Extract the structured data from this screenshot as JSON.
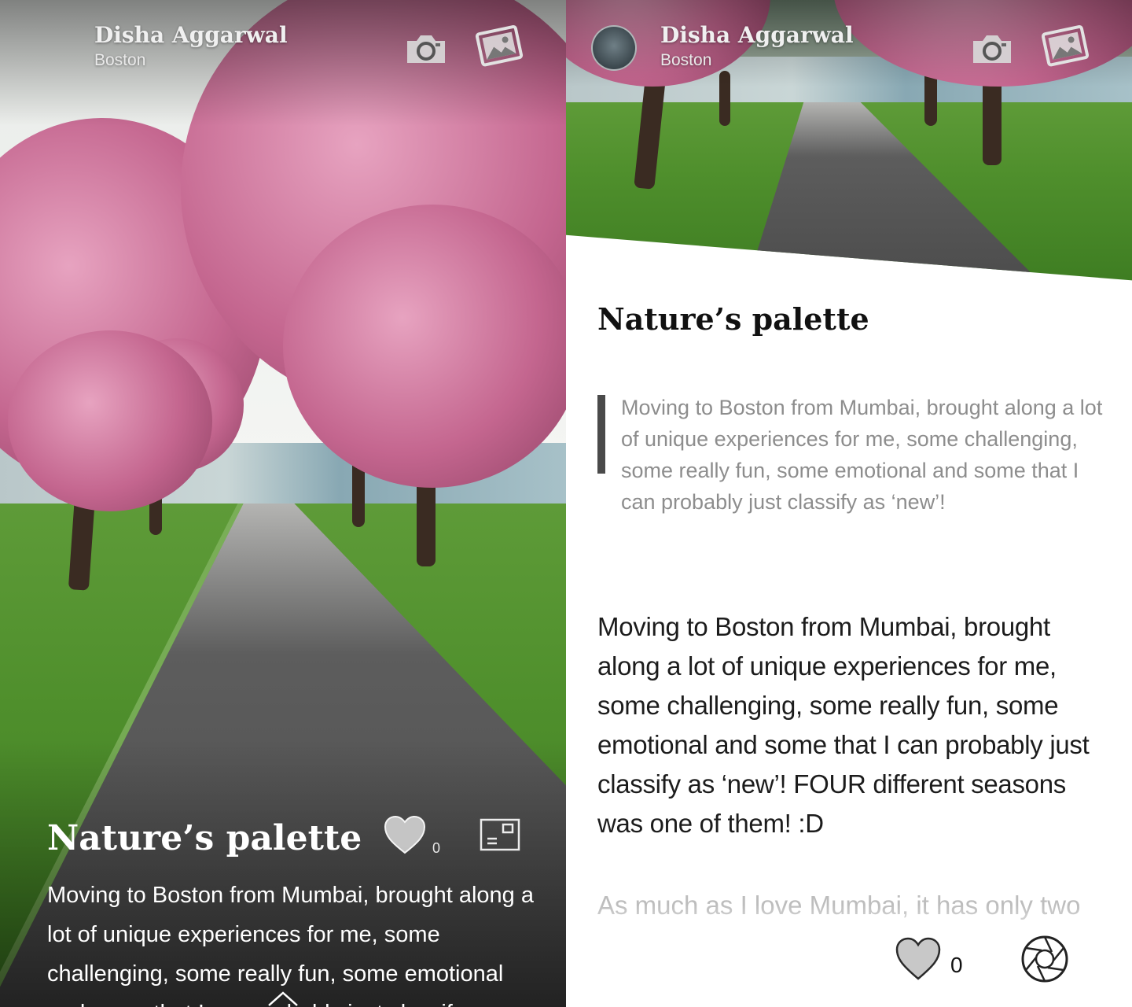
{
  "left_panel": {
    "author": {
      "name": "Disha Aggarwal",
      "location": "Boston"
    },
    "icons": {
      "camera": "camera-icon",
      "gallery": "gallery-icon",
      "like": "heart-icon",
      "card": "card-view-icon",
      "expand": "chevron-up-icon"
    },
    "post": {
      "title": "Nature’s palette",
      "like_count": "0",
      "excerpt": "Moving to Boston from Mumbai, brought along a lot of unique experiences for me, some challenging, some really fun, some emotional and some that I can probably just classify as"
    }
  },
  "right_panel": {
    "author": {
      "name": "Disha Aggarwal",
      "location": "Boston"
    },
    "icons": {
      "avatar": "avatar",
      "camera": "camera-icon",
      "gallery": "gallery-icon",
      "like": "heart-icon",
      "shutter": "shutter-icon"
    },
    "post": {
      "title": "Nature’s palette",
      "quote": "Moving to Boston from Mumbai, brought along a lot of unique experiences for me, some challenging, some really fun, some emotional and some that I can probably just classify as ‘new’!",
      "body": "Moving to Boston from Mumbai, brought along a lot of unique experiences for me, some challenging, some really fun, some emotional and some that I can probably just classify as ‘new’! FOUR different seasons was one of them! :D",
      "body_continued": "As much as I love Mumbai, it has only two",
      "like_count": "0"
    }
  },
  "colors": {
    "heart_fill": "#c8c8c8",
    "quote_bar": "#4a4a4a",
    "title_text": "#111111"
  }
}
